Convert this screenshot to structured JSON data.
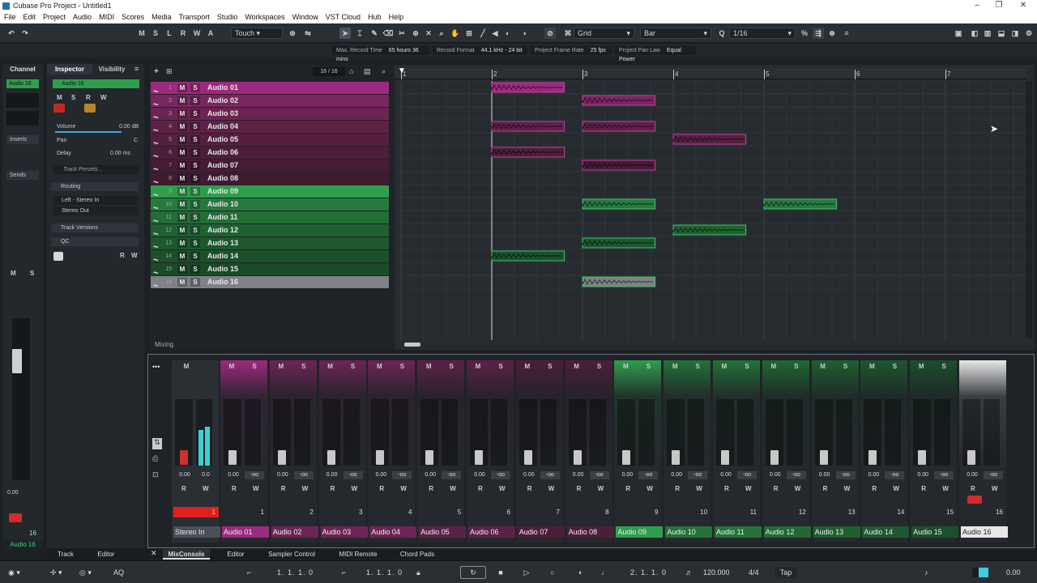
{
  "window": {
    "title": "Cubase Pro Project - Untitled1"
  },
  "menu": [
    "File",
    "Edit",
    "Project",
    "Audio",
    "MIDI",
    "Scores",
    "Media",
    "Transport",
    "Studio",
    "Workspaces",
    "Window",
    "VST Cloud",
    "Hub",
    "Help"
  ],
  "toolbar": {
    "state_buttons": [
      "M",
      "S",
      "L",
      "R",
      "W",
      "A"
    ],
    "automation_mode": "Touch",
    "grid_type": "Grid",
    "grid_unit": "Bar",
    "quantize": "1/16"
  },
  "infoline": [
    {
      "label": "Max. Record Time",
      "value": "65 hours 36 mins"
    },
    {
      "label": "Record Format",
      "value": "44.1 kHz - 24 bit"
    },
    {
      "label": "Project Frame Rate",
      "value": "25 fps"
    },
    {
      "label": "Project Pan Law",
      "value": "Equal Power"
    }
  ],
  "left_tabs": {
    "channel": "Channel",
    "inspector": "Inspector",
    "visibility": "Visibility"
  },
  "channel": {
    "name": "Audio 16",
    "inserts": "Inserts",
    "sends": "Sends",
    "fader_value": "0.00",
    "channel_number": "16"
  },
  "inspector": {
    "track_name": "Audio 16",
    "volume_label": "Volume",
    "volume_value": "0.00 dB",
    "pan_label": "Pan",
    "pan_value": "C",
    "delay_label": "Delay",
    "delay_value": "0.00 ms",
    "track_presets": "Track Presets...",
    "routing": "Routing",
    "input": "Left - Stereo In",
    "output": "Stereo Out",
    "track_versions": "Track Versions",
    "qc": "QC"
  },
  "tracklist": {
    "counter": "16 / 16",
    "bottom_label": "Mixing"
  },
  "tracks": [
    {
      "num": "1",
      "name": "Audio 01",
      "color": "#9c2a7e"
    },
    {
      "num": "2",
      "name": "Audio 02",
      "color": "#7a2760"
    },
    {
      "num": "3",
      "name": "Audio 03",
      "color": "#6c2452"
    },
    {
      "num": "4",
      "name": "Audio 04",
      "color": "#5e2247"
    },
    {
      "num": "5",
      "name": "Audio 05",
      "color": "#55203f"
    },
    {
      "num": "6",
      "name": "Audio 06",
      "color": "#4c1e39"
    },
    {
      "num": "7",
      "name": "Audio 07",
      "color": "#451c34"
    },
    {
      "num": "8",
      "name": "Audio 08",
      "color": "#3f1b30"
    },
    {
      "num": "9",
      "name": "Audio 09",
      "color": "#2f9e4c"
    },
    {
      "num": "10",
      "name": "Audio 10",
      "color": "#277a3d"
    },
    {
      "num": "11",
      "name": "Audio 11",
      "color": "#236d37"
    },
    {
      "num": "12",
      "name": "Audio 12",
      "color": "#1f6232"
    },
    {
      "num": "13",
      "name": "Audio 13",
      "color": "#1d582e"
    },
    {
      "num": "14",
      "name": "Audio 14",
      "color": "#1b502b"
    },
    {
      "num": "15",
      "name": "Audio 15",
      "color": "#1a4a28"
    },
    {
      "num": "16",
      "name": "Audio 16",
      "color": "#7e8286"
    }
  ],
  "ruler": [
    "1",
    "2",
    "3",
    "4",
    "5",
    "6",
    "7"
  ],
  "events": [
    {
      "track": 1,
      "start": 2,
      "end": 2.8
    },
    {
      "track": 2,
      "start": 3,
      "end": 3.8
    },
    {
      "track": 4,
      "start": 2,
      "end": 2.8
    },
    {
      "track": 4,
      "start": 3,
      "end": 3.8
    },
    {
      "track": 5,
      "start": 4,
      "end": 4.8
    },
    {
      "track": 6,
      "start": 2,
      "end": 2.8
    },
    {
      "track": 7,
      "start": 3,
      "end": 3.8
    },
    {
      "track": 10,
      "start": 3,
      "end": 3.8
    },
    {
      "track": 10,
      "start": 5,
      "end": 5.8
    },
    {
      "track": 12,
      "start": 4,
      "end": 4.8
    },
    {
      "track": 13,
      "start": 3,
      "end": 3.8
    },
    {
      "track": 14,
      "start": 2,
      "end": 2.8
    },
    {
      "track": 16,
      "start": 3,
      "end": 3.8
    }
  ],
  "mixer": {
    "stereo_in": {
      "name": "Stereo In",
      "values": [
        "0.00",
        "0.0"
      ],
      "num": "1"
    },
    "strips": [
      {
        "name": "Audio 01",
        "num": "1",
        "color": "#9c2a7e",
        "val": "0.00",
        "peak": "-oo"
      },
      {
        "name": "Audio 02",
        "num": "2",
        "color": "#6e2456",
        "val": "0.00",
        "peak": "-oo"
      },
      {
        "name": "Audio 03",
        "num": "3",
        "color": "#6e2456",
        "val": "0.00",
        "peak": "-oo"
      },
      {
        "name": "Audio 04",
        "num": "4",
        "color": "#6e2456",
        "val": "0.00",
        "peak": "-oo"
      },
      {
        "name": "Audio 05",
        "num": "5",
        "color": "#5c2146",
        "val": "0.00",
        "peak": "-oo"
      },
      {
        "name": "Audio 06",
        "num": "6",
        "color": "#5c2146",
        "val": "0.00",
        "peak": "-oo"
      },
      {
        "name": "Audio 07",
        "num": "7",
        "color": "#4d1e3b",
        "val": "0.00",
        "peak": "-oo"
      },
      {
        "name": "Audio 08",
        "num": "8",
        "color": "#4d1e3b",
        "val": "0.00",
        "peak": "-oo"
      },
      {
        "name": "Audio 09",
        "num": "9",
        "color": "#2f9e4c",
        "val": "0.00",
        "peak": "-oo"
      },
      {
        "name": "Audio 10",
        "num": "10",
        "color": "#247239",
        "val": "0.00",
        "peak": "-oo"
      },
      {
        "name": "Audio 11",
        "num": "11",
        "color": "#247239",
        "val": "0.00",
        "peak": "-oo"
      },
      {
        "name": "Audio 12",
        "num": "12",
        "color": "#216834",
        "val": "0.00",
        "peak": "-oo"
      },
      {
        "name": "Audio 13",
        "num": "13",
        "color": "#1f6030",
        "val": "0.00",
        "peak": "-oo"
      },
      {
        "name": "Audio 14",
        "num": "14",
        "color": "#1d582e",
        "val": "0.00",
        "peak": "-oo"
      },
      {
        "name": "Audio 15",
        "num": "15",
        "color": "#1b502b",
        "val": "0.00",
        "peak": "-oo"
      },
      {
        "name": "Audio 16",
        "num": "16",
        "color": "#e8e8e8",
        "val": "0.00",
        "peak": "-oo"
      }
    ]
  },
  "bottom_tabs": {
    "track": "Track",
    "editor": "Editor",
    "mixconsole": "MixConsole",
    "editor2": "Editor",
    "sampler": "Sampler Control",
    "midi_remote": "MIDI Remote",
    "chord_pads": "Chord Pads"
  },
  "transport": {
    "left_locator": "1. 1. 1.  0",
    "right_locator": "1. 1. 1.  0",
    "position": "2. 1. 1.  0",
    "tempo": "120.000",
    "signature": "4/4",
    "tap": "Tap",
    "level": "0.00"
  }
}
